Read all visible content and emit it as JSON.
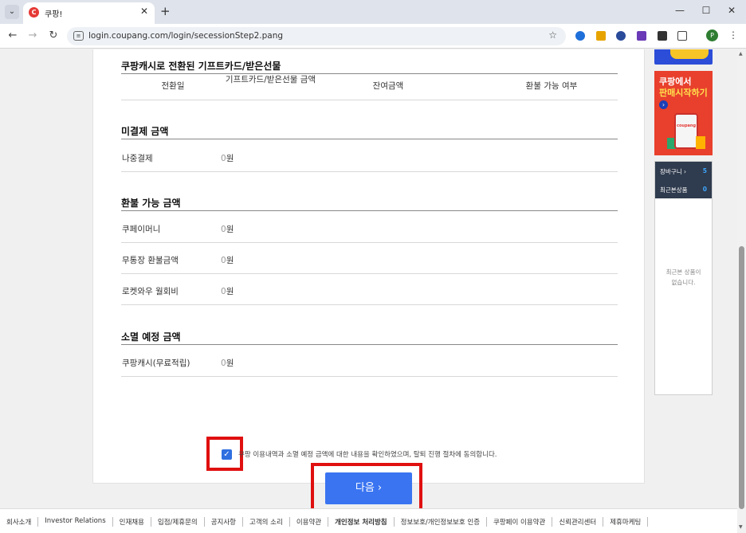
{
  "browser": {
    "tab_title": "쿠팡!",
    "url": "login.coupang.com/login/secessionStep2.pang",
    "profile_initial": "P"
  },
  "content": {
    "giftcard_section": {
      "title": "쿠팡캐시로 전환된 기프트카드/받은선물",
      "columns": [
        "전환일",
        "기프트카드/받은선물 금액",
        "잔여금액",
        "환불 가능 여부"
      ]
    },
    "unpaid_section": {
      "title": "미결제 금액",
      "rows": [
        {
          "label": "나중결제",
          "zero": "0",
          "unit": "원"
        }
      ]
    },
    "refund_section": {
      "title": "환불 가능 금액",
      "rows": [
        {
          "label": "쿠페이머니",
          "zero": "0",
          "unit": "원"
        },
        {
          "label": "무통장 환불금액",
          "zero": "0",
          "unit": "원"
        },
        {
          "label": "로켓와우 월회비",
          "zero": "0",
          "unit": "원"
        }
      ]
    },
    "expire_section": {
      "title": "소멸 예정 금액",
      "rows": [
        {
          "label": "쿠팡캐시(무료적립)",
          "zero": "0",
          "unit": "원"
        }
      ]
    },
    "agreement_text": "쿠팡 이용내역과 소멸 예정 금액에 대한 내용을 확인하였으며, 탈퇴 진행 절차에 동의합니다.",
    "next_button": "다음 ›"
  },
  "sidebar": {
    "ad_title_1": "쿠팡에서",
    "ad_title_2": "판매시작하기",
    "ad_brand": "coupang",
    "cart_label": "장바구니 ›",
    "cart_count": "5",
    "recent_label": "최근본상품",
    "recent_count": "0",
    "recent_empty_1": "최근본 상품이",
    "recent_empty_2": "없습니다."
  },
  "footer": {
    "links": [
      "회사소개",
      "Investor Relations",
      "인재채용",
      "입점/제휴문의",
      "공지사항",
      "고객의 소리",
      "이용약관",
      "개인정보 처리방침",
      "정보보호/개인정보보호 인증",
      "쿠팡페이 이용약관",
      "신뢰관리센터",
      "제휴마케팅"
    ],
    "bold_index": 7
  }
}
